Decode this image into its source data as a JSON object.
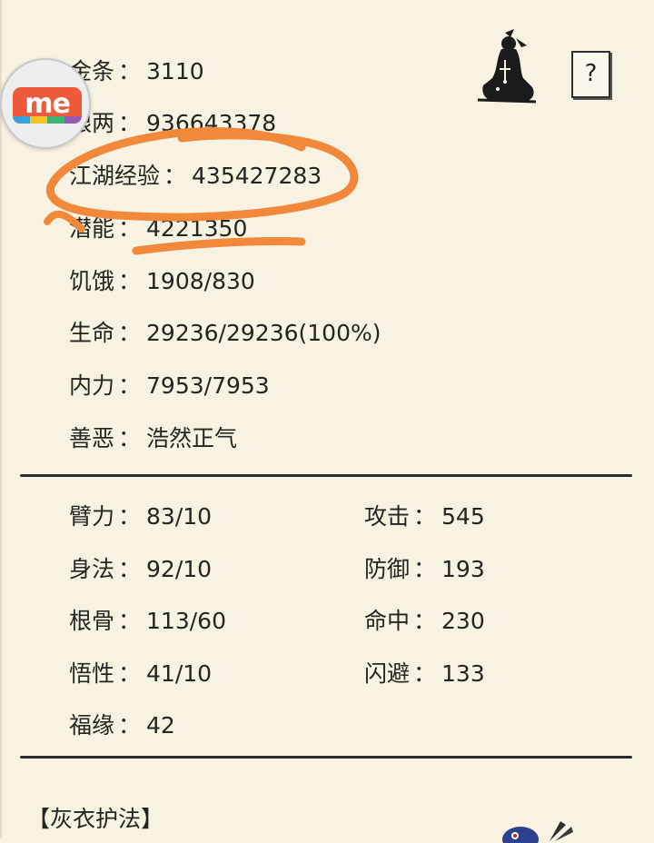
{
  "stats": {
    "sep": "：",
    "gold": {
      "label": "金条",
      "value": "3110"
    },
    "silver": {
      "label": "银两",
      "value": "936643378"
    },
    "exp": {
      "label": "江湖经验",
      "value": "435427283"
    },
    "potential": {
      "label": "潜能",
      "value": "4221350"
    },
    "hunger": {
      "label": "饥饿",
      "value": "1908/830"
    },
    "hp": {
      "label": "生命",
      "value": "29236/29236(100%)"
    },
    "mp": {
      "label": "内力",
      "value": "7953/7953"
    },
    "morality": {
      "label": "善恶",
      "value": "浩然正气"
    }
  },
  "attributes": {
    "left": [
      {
        "label": "臂力",
        "value": "83/10"
      },
      {
        "label": "身法",
        "value": "92/10"
      },
      {
        "label": "根骨",
        "value": "113/60"
      },
      {
        "label": "悟性",
        "value": "41/10"
      },
      {
        "label": "福缘",
        "value": "42"
      }
    ],
    "right": [
      {
        "label": "攻击",
        "value": "545"
      },
      {
        "label": "防御",
        "value": "193"
      },
      {
        "label": "命中",
        "value": "230"
      },
      {
        "label": "闪避",
        "value": "133"
      }
    ]
  },
  "help_button": {
    "label": "?"
  },
  "badge": {
    "text": "me"
  },
  "section": {
    "title": "【灰衣护法】"
  },
  "colors": {
    "background": "#f8f2e2",
    "annotation": "#f2883a",
    "text": "#262421"
  },
  "icons": [
    "character-avatar-icon",
    "me-app-icon",
    "bird-icon"
  ]
}
